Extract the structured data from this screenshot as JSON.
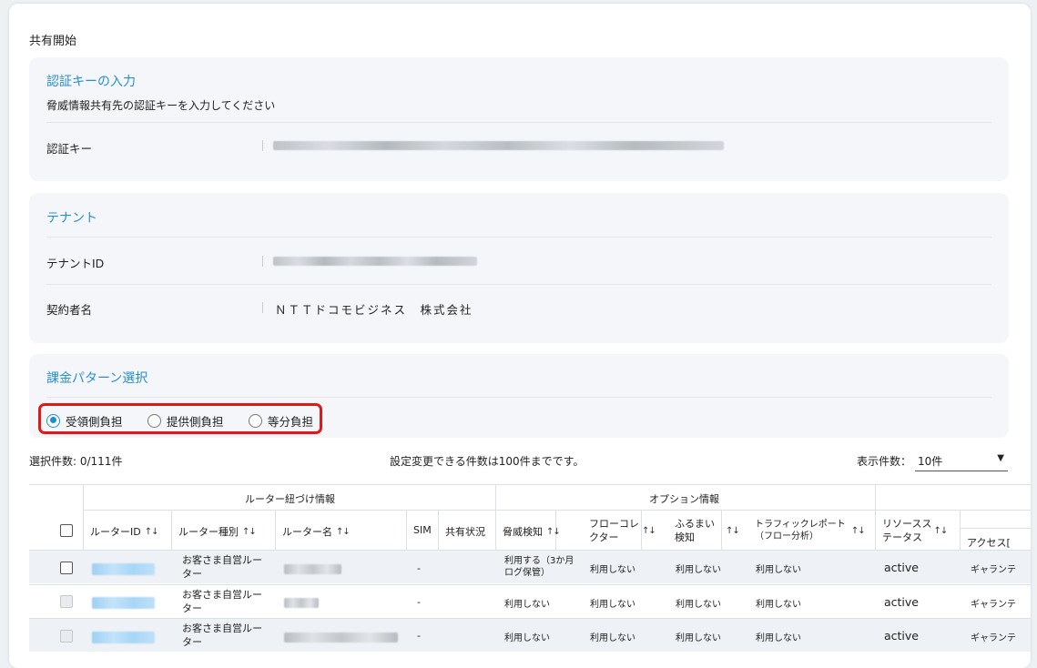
{
  "page": {
    "title": "共有開始"
  },
  "auth_section": {
    "title": "認証キーの入力",
    "description": "脅威情報共有先の認証キーを入力してください",
    "key_label": "認証キー"
  },
  "tenant_section": {
    "title": "テナント",
    "tenant_id_label": "テナントID",
    "contractor_label": "契約者名",
    "contractor_value": "ＮＴＴドコモビジネス　株式会社"
  },
  "billing_section": {
    "title": "課金パターン選択",
    "options": [
      {
        "label": "受領側負担",
        "selected": true
      },
      {
        "label": "提供側負担",
        "selected": false
      },
      {
        "label": "等分負担",
        "selected": false
      }
    ]
  },
  "table_info": {
    "selected_count": "選択件数: 0/111件",
    "limit_note": "設定変更できる件数は100件までです。",
    "page_size_label": "表示件数：",
    "page_size_value": "10件"
  },
  "table": {
    "group_headers": [
      "ルーター紐づけ情報",
      "オプション情報"
    ],
    "columns": {
      "router_id": "ルーターID",
      "router_type": "ルーター種別",
      "router_name": "ルーター名",
      "sim": "SIM",
      "share_status": "共有状況",
      "threat_detect": "脅威検知",
      "flow_collector_1": "フローコレ",
      "flow_collector_2": "クター",
      "behavior_1": "ふるまい",
      "behavior_2": "検知",
      "traffic_1": "トラフィックレポート",
      "traffic_2": "（フロー分析）",
      "resource_1": "リソースス",
      "resource_2": "テータス",
      "access": "アクセス[",
      "sort_glyph": "↑↓"
    },
    "rows": [
      {
        "type_1": "お客さま自営ルー",
        "type_2": "ター",
        "sim": "-",
        "threat_1": "利用する（3か月",
        "threat_2": "ログ保管）",
        "flow": "利用しない",
        "behavior": "利用しない",
        "traffic": "利用しない",
        "resource": "active",
        "access": "ギャランテ"
      },
      {
        "type_1": "お客さま自営ルー",
        "type_2": "ター",
        "sim": "-",
        "threat_1": "利用しない",
        "threat_2": "",
        "flow": "利用しない",
        "behavior": "利用しない",
        "traffic": "利用しない",
        "resource": "active",
        "access": "ギャランテ"
      },
      {
        "type_1": "お客さま自営ルー",
        "type_2": "ター",
        "sim": "-",
        "threat_1": "利用しない",
        "threat_2": "",
        "flow": "利用しない",
        "behavior": "利用しない",
        "traffic": "利用しない",
        "resource": "active",
        "access": "ギャランテ"
      }
    ]
  },
  "colors": {
    "accent": "#2a8fd1",
    "radio_selected": "#1a8fd6",
    "highlight_border": "#e01818"
  }
}
